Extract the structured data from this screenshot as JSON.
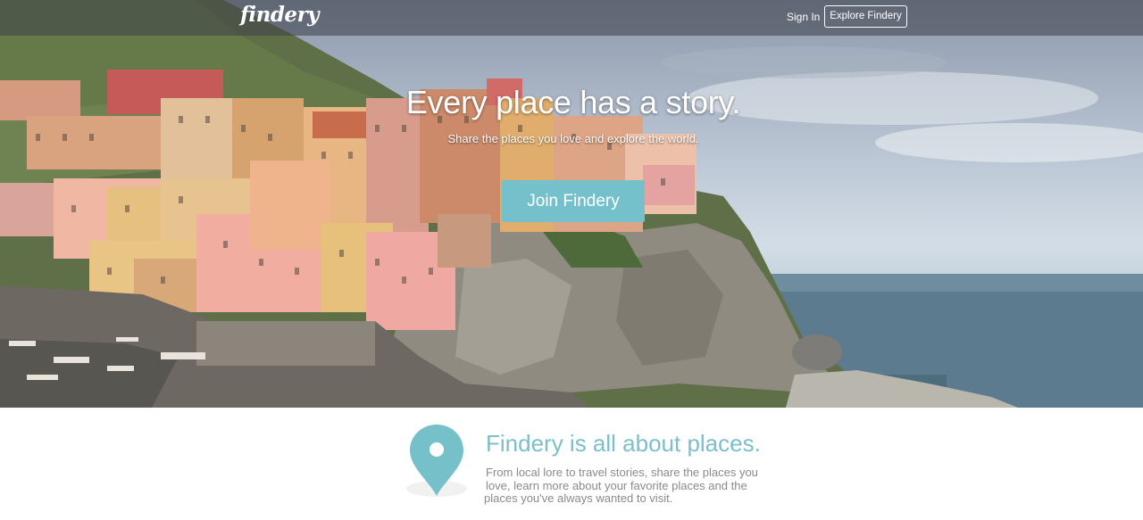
{
  "nav": {
    "logo": "findery",
    "sign_in": "Sign In",
    "explore_button": "Explore Findery"
  },
  "hero": {
    "headline": "Every place has a story.",
    "subline": "Share the places you love and explore the world.",
    "join_button": "Join Findery"
  },
  "about": {
    "title": "Findery is all about places.",
    "text_lines": [
      "From local lore to travel stories, share the places you",
      "love, learn more about your favorite places and the",
      "places you've always wanted to visit."
    ]
  },
  "colors": {
    "accent": "#74c1cb",
    "title": "#7bbfc8",
    "body_text": "#8a8a8a"
  },
  "icons": {
    "location": "map-pin-icon"
  }
}
